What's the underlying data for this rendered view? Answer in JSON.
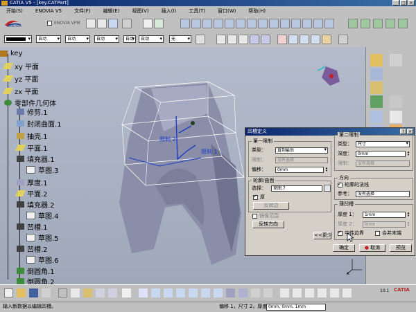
{
  "window": {
    "title": "CATIA V5 - [key.CATPart]",
    "min": "_",
    "max": "□",
    "close": "×"
  },
  "menu": [
    "开始(S)",
    "ENOVIA V5",
    "文件(F)",
    "编辑(E)",
    "视图(V)",
    "插入(I)",
    "工具(T)",
    "窗口(W)",
    "帮助(H)"
  ],
  "toolbar": {
    "enovia_label": "ENOVIA VPM",
    "enovia_logo": "ENOVIA",
    "combo1": "",
    "combo2": "自动",
    "combo3": "自动",
    "combo4": "自动",
    "combo5": "自动",
    "combo6": "自动",
    "combo7": "无"
  },
  "tree": {
    "root": "key",
    "items": [
      {
        "label": "xy 平面",
        "icon": "plane-icon"
      },
      {
        "label": "yz 平面",
        "icon": "plane-icon"
      },
      {
        "label": "zx 平面",
        "icon": "plane-icon"
      },
      {
        "label": "零部件几何体",
        "icon": "body-icon"
      },
      {
        "label": "修剪.1",
        "icon": "trim-icon"
      },
      {
        "label": "封闭曲面.1",
        "icon": "close-surface-icon"
      },
      {
        "label": "抽壳.1",
        "icon": "shell-icon"
      },
      {
        "label": "平面.1",
        "icon": "plane-icon"
      },
      {
        "label": "填充器.1",
        "icon": "pad-icon"
      },
      {
        "label": "草图.3",
        "icon": "sketch-icon"
      },
      {
        "label": "厚度.1",
        "icon": "thickness-icon"
      },
      {
        "label": "平面.2",
        "icon": "plane-icon"
      },
      {
        "label": "填充器.2",
        "icon": "pad-icon"
      },
      {
        "label": "草图.4",
        "icon": "sketch-icon"
      },
      {
        "label": "凹槽.1",
        "icon": "pocket-icon"
      },
      {
        "label": "草图.5",
        "icon": "sketch-icon"
      },
      {
        "label": "凹槽.2",
        "icon": "pocket-icon"
      },
      {
        "label": "草图.6",
        "icon": "sketch-icon"
      },
      {
        "label": "倒圆角.1",
        "icon": "fillet-icon"
      },
      {
        "label": "倒圆角.2",
        "icon": "fillet-icon"
      }
    ]
  },
  "viewport": {
    "limit_label_1": "限制 1",
    "limit_label_2": "限制 2",
    "axis_label": "x"
  },
  "dialog": {
    "title": "凹槽定义",
    "help": "?",
    "close": "×",
    "first_limit": {
      "group": "第一限制",
      "type_label": "类型：",
      "type_value": "直到最后",
      "limit_label": "限制：",
      "limit_value": "没有选择",
      "offset_label": "偏移：",
      "offset_value": "0mm"
    },
    "profile": {
      "group": "轮廓/曲面",
      "select_label": "选择：",
      "select_value": "草图.7",
      "thick_label": "厚",
      "reverse_side": "反转边",
      "mirror_label": "镜像范围",
      "reverse_dir": "反转方向",
      "less_button": "<<更少"
    },
    "second_limit": {
      "group": "第二限制",
      "type_label": "类型：",
      "type_value": "尺寸",
      "depth_label": "深度：",
      "depth_value": "0mm",
      "limit_label": "限制：",
      "limit_value": "没有选择"
    },
    "direction": {
      "group": "方向",
      "normal_label": "轮廓的法线",
      "ref_label": "参考：",
      "ref_value": "没有选择"
    },
    "thin_pocket": {
      "group": "薄凹槽",
      "thick1_label": "厚度 1：",
      "thick1_value": "1mm",
      "thick2_label": "厚度 2：",
      "thick2_value": "0mm",
      "neutral_label": "中性边界",
      "merge_label": "合并末端"
    },
    "ok": "确定",
    "cancel": "取消",
    "preview": "预览"
  },
  "status": {
    "message": "输入新数据以编辑凹槽。",
    "right_text": "偏移 1，尺寸 2，厚度 1：",
    "right_field": "0mm, 0mm, 1mm"
  },
  "brand": {
    "catia_text": "CATIA",
    "version": "10.1"
  },
  "colors": {
    "titlebar": "#0a246a",
    "viewport_top": "#b4bccc",
    "part": "#8a8ea8",
    "constraint_blue": "#1a3cc8",
    "dialog_bg": "#d4d0c8"
  }
}
